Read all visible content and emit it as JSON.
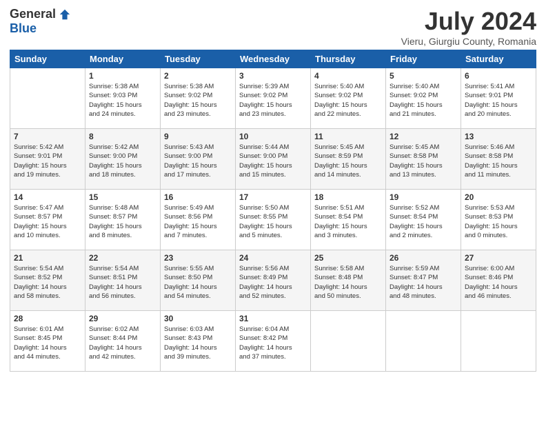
{
  "header": {
    "logo": {
      "general": "General",
      "blue": "Blue"
    },
    "title": "July 2024",
    "subtitle": "Vieru, Giurgiu County, Romania"
  },
  "calendar": {
    "headers": [
      "Sunday",
      "Monday",
      "Tuesday",
      "Wednesday",
      "Thursday",
      "Friday",
      "Saturday"
    ],
    "weeks": [
      [
        {
          "day": "",
          "info": ""
        },
        {
          "day": "1",
          "info": "Sunrise: 5:38 AM\nSunset: 9:03 PM\nDaylight: 15 hours\nand 24 minutes."
        },
        {
          "day": "2",
          "info": "Sunrise: 5:38 AM\nSunset: 9:02 PM\nDaylight: 15 hours\nand 23 minutes."
        },
        {
          "day": "3",
          "info": "Sunrise: 5:39 AM\nSunset: 9:02 PM\nDaylight: 15 hours\nand 23 minutes."
        },
        {
          "day": "4",
          "info": "Sunrise: 5:40 AM\nSunset: 9:02 PM\nDaylight: 15 hours\nand 22 minutes."
        },
        {
          "day": "5",
          "info": "Sunrise: 5:40 AM\nSunset: 9:02 PM\nDaylight: 15 hours\nand 21 minutes."
        },
        {
          "day": "6",
          "info": "Sunrise: 5:41 AM\nSunset: 9:01 PM\nDaylight: 15 hours\nand 20 minutes."
        }
      ],
      [
        {
          "day": "7",
          "info": "Sunrise: 5:42 AM\nSunset: 9:01 PM\nDaylight: 15 hours\nand 19 minutes."
        },
        {
          "day": "8",
          "info": "Sunrise: 5:42 AM\nSunset: 9:00 PM\nDaylight: 15 hours\nand 18 minutes."
        },
        {
          "day": "9",
          "info": "Sunrise: 5:43 AM\nSunset: 9:00 PM\nDaylight: 15 hours\nand 17 minutes."
        },
        {
          "day": "10",
          "info": "Sunrise: 5:44 AM\nSunset: 9:00 PM\nDaylight: 15 hours\nand 15 minutes."
        },
        {
          "day": "11",
          "info": "Sunrise: 5:45 AM\nSunset: 8:59 PM\nDaylight: 15 hours\nand 14 minutes."
        },
        {
          "day": "12",
          "info": "Sunrise: 5:45 AM\nSunset: 8:58 PM\nDaylight: 15 hours\nand 13 minutes."
        },
        {
          "day": "13",
          "info": "Sunrise: 5:46 AM\nSunset: 8:58 PM\nDaylight: 15 hours\nand 11 minutes."
        }
      ],
      [
        {
          "day": "14",
          "info": "Sunrise: 5:47 AM\nSunset: 8:57 PM\nDaylight: 15 hours\nand 10 minutes."
        },
        {
          "day": "15",
          "info": "Sunrise: 5:48 AM\nSunset: 8:57 PM\nDaylight: 15 hours\nand 8 minutes."
        },
        {
          "day": "16",
          "info": "Sunrise: 5:49 AM\nSunset: 8:56 PM\nDaylight: 15 hours\nand 7 minutes."
        },
        {
          "day": "17",
          "info": "Sunrise: 5:50 AM\nSunset: 8:55 PM\nDaylight: 15 hours\nand 5 minutes."
        },
        {
          "day": "18",
          "info": "Sunrise: 5:51 AM\nSunset: 8:54 PM\nDaylight: 15 hours\nand 3 minutes."
        },
        {
          "day": "19",
          "info": "Sunrise: 5:52 AM\nSunset: 8:54 PM\nDaylight: 15 hours\nand 2 minutes."
        },
        {
          "day": "20",
          "info": "Sunrise: 5:53 AM\nSunset: 8:53 PM\nDaylight: 15 hours\nand 0 minutes."
        }
      ],
      [
        {
          "day": "21",
          "info": "Sunrise: 5:54 AM\nSunset: 8:52 PM\nDaylight: 14 hours\nand 58 minutes."
        },
        {
          "day": "22",
          "info": "Sunrise: 5:54 AM\nSunset: 8:51 PM\nDaylight: 14 hours\nand 56 minutes."
        },
        {
          "day": "23",
          "info": "Sunrise: 5:55 AM\nSunset: 8:50 PM\nDaylight: 14 hours\nand 54 minutes."
        },
        {
          "day": "24",
          "info": "Sunrise: 5:56 AM\nSunset: 8:49 PM\nDaylight: 14 hours\nand 52 minutes."
        },
        {
          "day": "25",
          "info": "Sunrise: 5:58 AM\nSunset: 8:48 PM\nDaylight: 14 hours\nand 50 minutes."
        },
        {
          "day": "26",
          "info": "Sunrise: 5:59 AM\nSunset: 8:47 PM\nDaylight: 14 hours\nand 48 minutes."
        },
        {
          "day": "27",
          "info": "Sunrise: 6:00 AM\nSunset: 8:46 PM\nDaylight: 14 hours\nand 46 minutes."
        }
      ],
      [
        {
          "day": "28",
          "info": "Sunrise: 6:01 AM\nSunset: 8:45 PM\nDaylight: 14 hours\nand 44 minutes."
        },
        {
          "day": "29",
          "info": "Sunrise: 6:02 AM\nSunset: 8:44 PM\nDaylight: 14 hours\nand 42 minutes."
        },
        {
          "day": "30",
          "info": "Sunrise: 6:03 AM\nSunset: 8:43 PM\nDaylight: 14 hours\nand 39 minutes."
        },
        {
          "day": "31",
          "info": "Sunrise: 6:04 AM\nSunset: 8:42 PM\nDaylight: 14 hours\nand 37 minutes."
        },
        {
          "day": "",
          "info": ""
        },
        {
          "day": "",
          "info": ""
        },
        {
          "day": "",
          "info": ""
        }
      ]
    ]
  }
}
